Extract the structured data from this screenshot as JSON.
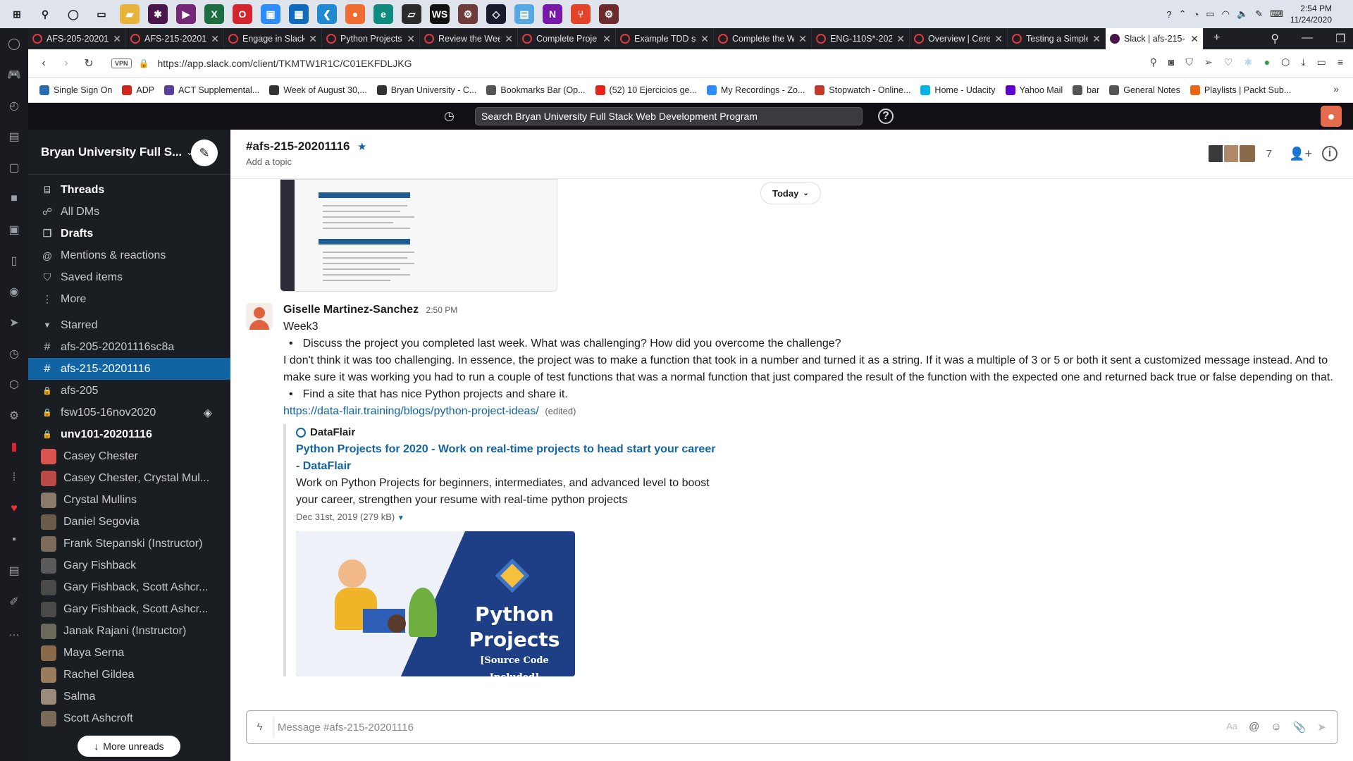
{
  "taskbar": {
    "icons": [
      {
        "name": "windows-start-icon",
        "color": "#1d1d1d",
        "glyph": "⊞"
      },
      {
        "name": "search-icon",
        "color": "#1d1d1d",
        "glyph": "⚲"
      },
      {
        "name": "cortana-icon",
        "color": "#1d1d1d",
        "glyph": "◯"
      },
      {
        "name": "task-view-icon",
        "color": "#1d1d1d",
        "glyph": "▭"
      },
      {
        "name": "file-explorer-icon",
        "color": "#e8b33a",
        "glyph": "▰"
      },
      {
        "name": "slack-app-icon",
        "color": "#4a154b",
        "glyph": "✱"
      },
      {
        "name": "powerapps-icon",
        "color": "#742774",
        "glyph": "▶"
      },
      {
        "name": "excel-icon",
        "color": "#1d6f42",
        "glyph": "X"
      },
      {
        "name": "opera-icon",
        "color": "#d4252f",
        "glyph": "O"
      },
      {
        "name": "zoom-icon",
        "color": "#2d8cff",
        "glyph": "▣"
      },
      {
        "name": "outlook-icon",
        "color": "#0f6cbd",
        "glyph": "▦"
      },
      {
        "name": "vscode-icon",
        "color": "#1f8ad2",
        "glyph": "❮"
      },
      {
        "name": "postman-icon",
        "color": "#ef6c33",
        "glyph": "●"
      },
      {
        "name": "edge-icon",
        "color": "#0e8a7e",
        "glyph": "e"
      },
      {
        "name": "sticky-notes-icon",
        "color": "#2b2b2b",
        "glyph": "▱"
      },
      {
        "name": "webstorm-icon",
        "color": "#111111",
        "glyph": "WS"
      },
      {
        "name": "rust-icon",
        "color": "#6e3a3a",
        "glyph": "⚙"
      },
      {
        "name": "unity-icon",
        "color": "#1a1a2e",
        "glyph": "◇"
      },
      {
        "name": "photos-icon",
        "color": "#56a8e4",
        "glyph": "▤"
      },
      {
        "name": "onenote-icon",
        "color": "#7719aa",
        "glyph": "N"
      },
      {
        "name": "git-icon",
        "color": "#e24329",
        "glyph": "⑂"
      },
      {
        "name": "chrome-dev-icon",
        "color": "#6d2c2c",
        "glyph": "⚙"
      }
    ],
    "clock_time": "2:54 PM",
    "clock_date": "11/24/2020"
  },
  "tabs": [
    {
      "title": "AFS-205-20201",
      "active": false
    },
    {
      "title": "AFS-215-20201",
      "active": false
    },
    {
      "title": "Engage in Slack",
      "active": false
    },
    {
      "title": "Python Projects",
      "active": false
    },
    {
      "title": "Review the Wee",
      "active": false
    },
    {
      "title": "Complete Proje",
      "active": false
    },
    {
      "title": "Example TDD sc",
      "active": false
    },
    {
      "title": "Complete the W",
      "active": false
    },
    {
      "title": "ENG-110S*-202",
      "active": false
    },
    {
      "title": "Overview | Cere",
      "active": false
    },
    {
      "title": "Testing a Simple",
      "active": false
    },
    {
      "title": "Slack | afs-215-",
      "active": true
    }
  ],
  "browser": {
    "vpn_label": "VPN",
    "url": "https://app.slack.com/client/TKMTW1R1C/C01EKFDLJKG"
  },
  "bookmarks": [
    {
      "label": "Single Sign On",
      "color": "#2b6cb0"
    },
    {
      "label": "ADP",
      "color": "#d0271d"
    },
    {
      "label": "ACT Supplemental...",
      "color": "#5b3f99"
    },
    {
      "label": "Week of August 30,...",
      "color": "#333333"
    },
    {
      "label": "Bryan University - C...",
      "color": "#333333"
    },
    {
      "label": "Bookmarks Bar (Op...",
      "color": "#555555"
    },
    {
      "label": "(52) 10 Ejercicios ge...",
      "color": "#e62117"
    },
    {
      "label": "My Recordings - Zo...",
      "color": "#2d8cff"
    },
    {
      "label": "Stopwatch - Online...",
      "color": "#c0392b"
    },
    {
      "label": "Home - Udacity",
      "color": "#02b3e4"
    },
    {
      "label": "Yahoo Mail",
      "color": "#6001d2"
    },
    {
      "label": "bar",
      "color": "#555555"
    },
    {
      "label": "General Notes",
      "color": "#555555"
    },
    {
      "label": "Playlists | Packt Sub...",
      "color": "#ec6611"
    }
  ],
  "slack_top": {
    "search_label": "Search Bryan University Full Stack Web Development Program"
  },
  "sidebar": {
    "workspace": "Bryan University Full S...",
    "nav": [
      {
        "label": "Threads",
        "icon": "threads-icon",
        "glyph": "⌸",
        "bold": true
      },
      {
        "label": "All DMs",
        "icon": "dms-icon",
        "glyph": "☍",
        "bold": false
      },
      {
        "label": "Drafts",
        "icon": "drafts-icon",
        "glyph": "❐",
        "bold": true
      },
      {
        "label": "Mentions & reactions",
        "icon": "at-icon",
        "glyph": "@",
        "bold": false
      },
      {
        "label": "Saved items",
        "icon": "bookmark-icon",
        "glyph": "⛉",
        "bold": false
      },
      {
        "label": "More",
        "icon": "more-vertical-icon",
        "glyph": "⋮",
        "bold": false
      }
    ],
    "starred_label": "Starred",
    "channels": [
      {
        "label": "afs-205-20201116sc8a",
        "glyph": "#",
        "bold": false,
        "selected": false
      },
      {
        "label": "afs-215-20201116",
        "glyph": "#",
        "bold": false,
        "selected": true
      },
      {
        "label": "afs-205",
        "glyph": "🔒",
        "bold": false,
        "selected": false
      },
      {
        "label": "fsw105-16nov2020",
        "glyph": "🔒",
        "bold": false,
        "selected": false
      },
      {
        "label": "unv101-20201116",
        "glyph": "🔒",
        "bold": true,
        "selected": false
      }
    ],
    "dms": [
      {
        "label": "Casey Chester",
        "color": "#d9534f"
      },
      {
        "label": "Casey Chester, Crystal Mul...",
        "color": "#b94a48"
      },
      {
        "label": "Crystal Mullins",
        "color": "#8a7a6a"
      },
      {
        "label": "Daniel Segovia",
        "color": "#6b5b4b"
      },
      {
        "label": "Frank Stepanski (Instructor)",
        "color": "#7d6b5a"
      },
      {
        "label": "Gary Fishback",
        "color": "#5a5a5a"
      },
      {
        "label": "Gary Fishback, Scott Ashcr...",
        "color": "#4a4a4a"
      },
      {
        "label": "Gary Fishback, Scott Ashcr...",
        "color": "#4a4a4a"
      },
      {
        "label": "Janak Rajani (Instructor)",
        "color": "#6a6a5a"
      },
      {
        "label": "Maya Serna",
        "color": "#8b6a4b"
      },
      {
        "label": "Rachel Gildea",
        "color": "#9a7b5b"
      },
      {
        "label": "Salma",
        "color": "#9b8b7b"
      },
      {
        "label": "Scott Ashcroft",
        "color": "#7a6a5a"
      }
    ],
    "more_unreads": "More unreads"
  },
  "channel": {
    "name": "#afs-215-20201116",
    "topic": "Add a topic",
    "member_count": "7",
    "today_label": "Today"
  },
  "message": {
    "sender": "Giselle Martinez-Sanchez",
    "time": "2:50 PM",
    "line1": "Week3",
    "bullet1": "Discuss the project you completed last week. What was challenging? How did you overcome the challenge?",
    "paragraph": "I don't think it was too challenging. In essence, the project was to make a function that took in a number and turned it as a string. If it was a multiple of 3 or 5 or both it sent a customized message instead. And to make sure it was working you had to run a couple of test functions that was a normal function that just compared the result of the function with the expected one and returned back true or false depending on that.",
    "bullet2": "Find a site that has nice Python projects and share it.",
    "link": "https://data-flair.training/blogs/python-project-ideas/",
    "edited": "(edited)",
    "unfurl": {
      "site": "DataFlair",
      "title": "Python Projects for 2020 - Work on real-time projects to head start your career - DataFlair",
      "description": "Work on Python Projects for beginners, intermediates, and advanced level to boost your career, strengthen your resume with real-time python projects",
      "meta": "Dec 31st, 2019 (279 kB)",
      "image_line1": "Python",
      "image_line2": "Projects",
      "image_caption": "[Source Code Included]"
    }
  },
  "composer": {
    "placeholder": "Message #afs-215-20201116"
  }
}
